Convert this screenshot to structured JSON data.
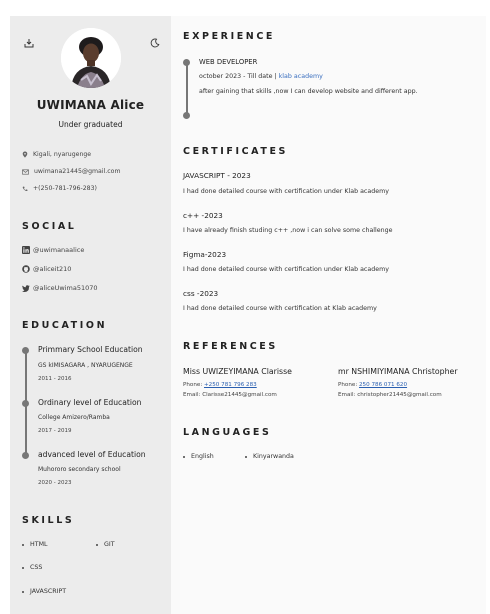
{
  "profile": {
    "name": "UWIMANA Alice",
    "status": "Under graduated",
    "location": "Kigali, nyarugenge",
    "email": "uwimana21445@gmail.com",
    "phone": "+(250-781-796-283)"
  },
  "icons": {
    "download": "download-icon",
    "theme": "moon-icon",
    "location": "location-pin-icon",
    "mail": "mail-icon",
    "phone": "phone-icon",
    "linkedin": "linkedin-icon",
    "github": "github-icon",
    "twitter": "twitter-icon"
  },
  "social": {
    "title": "SOCIAL",
    "items": [
      {
        "icon": "linkedin-icon",
        "label": "@uwimanaalice"
      },
      {
        "icon": "github-icon",
        "label": "@aliceit210"
      },
      {
        "icon": "twitter-icon",
        "label": "@aliceUwima51070"
      }
    ]
  },
  "education": {
    "title": "EDUCATION",
    "items": [
      {
        "degree": "Primmary School Education",
        "school": "GS kIMISAGARA , NYARUGENGE",
        "years": "2011 - 2016"
      },
      {
        "degree": "Ordinary level of Education",
        "school": "College Amizero/Ramba",
        "years": "2017 - 2019"
      },
      {
        "degree": "advanced level of Education",
        "school": "Muhororo secondary school",
        "years": "2020 - 2023"
      }
    ]
  },
  "skills": {
    "title": "SKILLS",
    "items": [
      "HTML",
      "GIT",
      "CSS",
      "JAVASCRIPT"
    ]
  },
  "experience": {
    "title": "EXPERIENCE",
    "role": "WEB DEVELOPER",
    "date": "october 2023 - Till date |",
    "company": "klab academy",
    "description": "after gaining that skills ,now I can develop website and different app."
  },
  "certificates": {
    "title": "CERTIFICATES",
    "items": [
      {
        "name": "JAVASCRIPT - 2023",
        "description": "I had done detailed course with certification under Klab academy"
      },
      {
        "name": "c++ -2023",
        "description": "I have already finish studing c++ ,now i can solve some challenge"
      },
      {
        "name": "Figma-2023",
        "description": "I had done detailed course with certification under Klab academy"
      },
      {
        "name": "css -2023",
        "description": "I had done detailed course with certification at Klab academy"
      }
    ]
  },
  "references": {
    "title": "REFERENCES",
    "items": [
      {
        "name": "Miss UWIZEYIMANA Clarisse",
        "phone_label": "Phone:",
        "phone": "+250 781 796 283",
        "email_label": "Email:",
        "email": "Clarisse21445@gmail.com"
      },
      {
        "name": "mr NSHIMIYIMANA Christopher",
        "phone_label": "Phone:",
        "phone": "250 786 071 620",
        "email_label": "Email:",
        "email": "christopher21445@gmail.com"
      }
    ]
  },
  "languages": {
    "title": "LANGUAGES",
    "items": [
      "English",
      "Kinyarwanda"
    ]
  },
  "colors": {
    "sidebar_bg": "#ececec",
    "main_bg": "#fafafa",
    "link": "#3a6fbf",
    "timeline": "#777777"
  }
}
